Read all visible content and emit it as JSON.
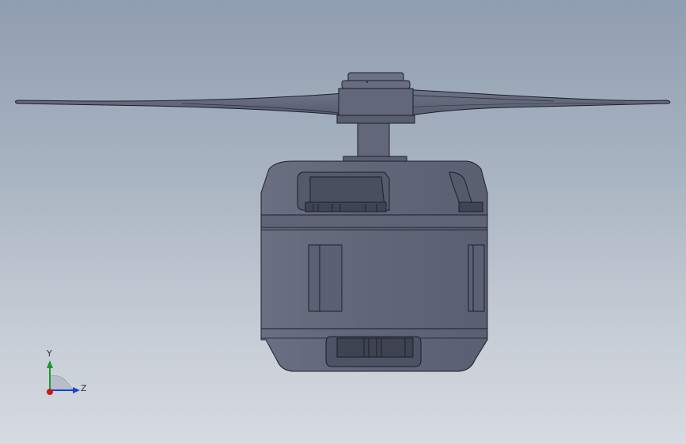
{
  "viewport": {
    "background_top": "#8f9eb0",
    "background_bottom": "#d6dbe1"
  },
  "model": {
    "name_icon": "motor-propeller-model",
    "body_color": "#62677a",
    "edge_color": "#1c1f28",
    "shade_color": "#4d5264"
  },
  "triad": {
    "y_label": "Y",
    "z_label": "Z",
    "y_color": "#1a9a2c",
    "z_color": "#1b3fd6",
    "x_color": "#c81a1a"
  }
}
